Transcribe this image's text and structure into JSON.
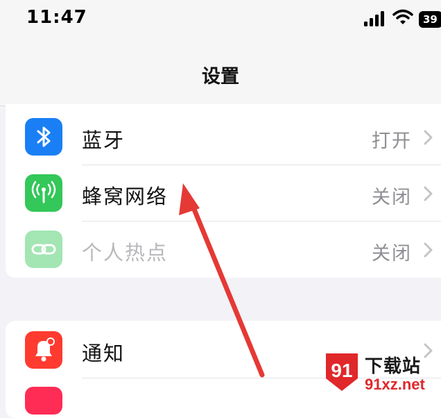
{
  "status_bar": {
    "time": "11:47",
    "battery": "39",
    "icons": [
      "cellular-signal-icon",
      "wifi-icon",
      "battery-icon"
    ]
  },
  "nav": {
    "title": "设置"
  },
  "groups": [
    {
      "rows": [
        {
          "label": "蓝牙",
          "value": "打开",
          "icon": "bluetooth-icon",
          "icon_color": "#1a7ff5",
          "enabled": true
        },
        {
          "label": "蜂窝网络",
          "value": "关闭",
          "icon": "cellular-antenna-icon",
          "icon_color": "#34c759",
          "enabled": true
        },
        {
          "label": "个人热点",
          "value": "关闭",
          "icon": "hotspot-link-icon",
          "icon_color": "#34c759",
          "enabled": false
        }
      ]
    },
    {
      "rows": [
        {
          "label": "通知",
          "value": "",
          "icon": "bell-icon",
          "icon_color": "#ff3b30",
          "enabled": true
        }
      ]
    }
  ],
  "annotation": {
    "type": "red-arrow",
    "target": "蜂窝网络",
    "color": "#e53935"
  },
  "watermark": {
    "brand": "下载站",
    "url": "91xz.net",
    "badge_text": "91",
    "color": "#e0282b"
  }
}
